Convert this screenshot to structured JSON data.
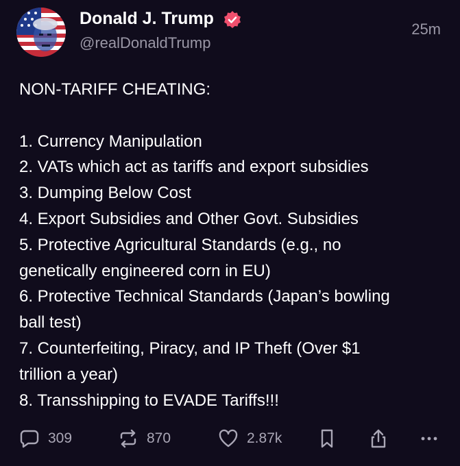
{
  "post": {
    "author_name": "Donald J. Trump",
    "handle": "@realDonaldTrump",
    "timestamp": "25m",
    "lines": [
      "NON-TARIFF CHEATING:",
      "",
      "1. Currency Manipulation",
      "2. VATs which act as tariffs and export subsidies",
      "3. Dumping Below Cost",
      "4. Export Subsidies and Other Govt. Subsidies",
      "5. Protective Agricultural Standards (e.g., no",
      "genetically engineered corn in EU)",
      "6. Protective Technical Standards (Japan’s bowling",
      "ball test)",
      "7. Counterfeiting, Piracy, and IP Theft (Over $1",
      "trillion a year)",
      "8. Transshipping to EVADE Tariffs!!!"
    ]
  },
  "actions": {
    "replies": "309",
    "reposts": "870",
    "likes": "2.87k"
  },
  "icons": {
    "verified": "verified-badge-icon",
    "reply": "reply-icon",
    "repost": "repost-icon",
    "like": "heart-icon",
    "bookmark": "bookmark-icon",
    "share": "share-icon",
    "more": "more-icon"
  },
  "colors": {
    "background": "#100c1c",
    "verified_badge": "#f0506e",
    "muted_text": "#9a97a6"
  }
}
